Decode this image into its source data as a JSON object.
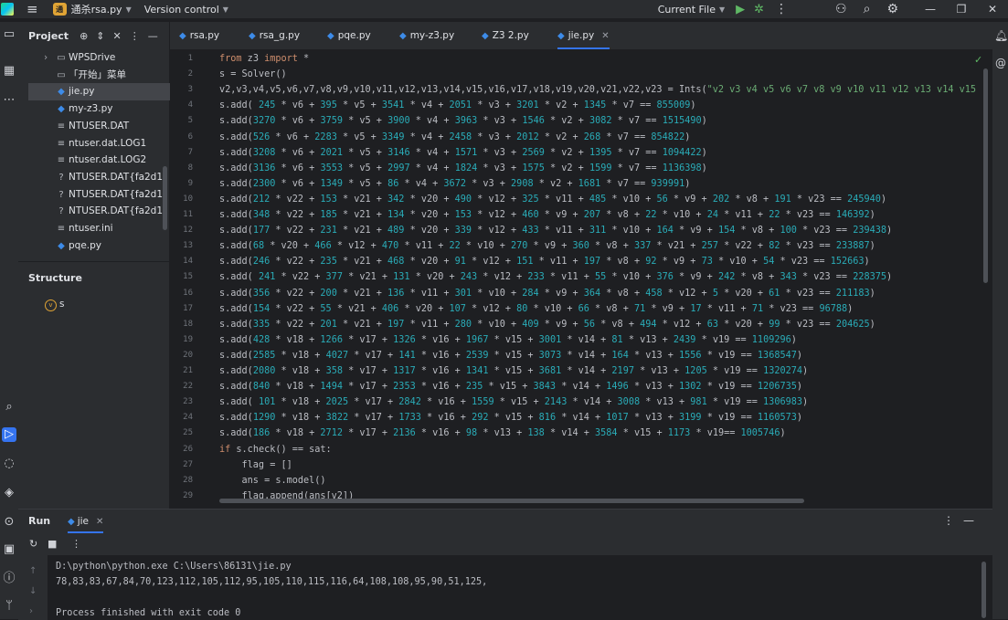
{
  "titlebar": {
    "project_badge": "通杀",
    "project_name": "通杀rsa.py",
    "vcs_label": "Version control",
    "current_file": "Current File"
  },
  "project_panel": {
    "title": "Project",
    "tree": [
      {
        "label": "WPSDrive",
        "type": "folder"
      },
      {
        "label": "「开始」菜单",
        "type": "folder"
      },
      {
        "label": "jie.py",
        "type": "py",
        "selected": true
      },
      {
        "label": "my-z3.py",
        "type": "py"
      },
      {
        "label": "NTUSER.DAT",
        "type": "file"
      },
      {
        "label": "ntuser.dat.LOG1",
        "type": "file"
      },
      {
        "label": "ntuser.dat.LOG2",
        "type": "file"
      },
      {
        "label": "NTUSER.DAT{fa2d155e-",
        "type": "unknown"
      },
      {
        "label": "NTUSER.DAT{fa2d155e-",
        "type": "unknown"
      },
      {
        "label": "NTUSER.DAT{fa2d155e-",
        "type": "unknown"
      },
      {
        "label": "ntuser.ini",
        "type": "file"
      },
      {
        "label": "pqe.py",
        "type": "py"
      }
    ],
    "structure_title": "Structure",
    "structure_item": "s"
  },
  "tabs": [
    {
      "label": "rsa.py"
    },
    {
      "label": "rsa_g.py"
    },
    {
      "label": "pqe.py"
    },
    {
      "label": "my-z3.py"
    },
    {
      "label": "Z3 2.py"
    },
    {
      "label": "jie.py",
      "active": true
    }
  ],
  "code_lines": [
    "from z3 import *",
    "s = Solver()",
    "v2,v3,v4,v5,v6,v7,v8,v9,v10,v11,v12,v13,v14,v15,v16,v17,v18,v19,v20,v21,v22,v23 = Ints(\"v2 v3 v4 v5 v6 v7 v8 v9 v10 v11 v12 v13 v14 v15",
    "s.add( 245 * v6 + 395 * v5 + 3541 * v4 + 2051 * v3 + 3201 * v2 + 1345 * v7 == 855009)",
    "s.add(3270 * v6 + 3759 * v5 + 3900 * v4 + 3963 * v3 + 1546 * v2 + 3082 * v7 == 1515490)",
    "s.add(526 * v6 + 2283 * v5 + 3349 * v4 + 2458 * v3 + 2012 * v2 + 268 * v7 == 854822)",
    "s.add(3208 * v6 + 2021 * v5 + 3146 * v4 + 1571 * v3 + 2569 * v2 + 1395 * v7 == 1094422)",
    "s.add(3136 * v6 + 3553 * v5 + 2997 * v4 + 1824 * v3 + 1575 * v2 + 1599 * v7 == 1136398)",
    "s.add(2300 * v6 + 1349 * v5 + 86 * v4 + 3672 * v3 + 2908 * v2 + 1681 * v7 == 939991)",
    "s.add(212 * v22 + 153 * v21 + 342 * v20 + 490 * v12 + 325 * v11 + 485 * v10 + 56 * v9 + 202 * v8 + 191 * v23 == 245940)",
    "s.add(348 * v22 + 185 * v21 + 134 * v20 + 153 * v12 + 460 * v9 + 207 * v8 + 22 * v10 + 24 * v11 + 22 * v23 == 146392)",
    "s.add(177 * v22 + 231 * v21 + 489 * v20 + 339 * v12 + 433 * v11 + 311 * v10 + 164 * v9 + 154 * v8 + 100 * v23 == 239438)",
    "s.add(68 * v20 + 466 * v12 + 470 * v11 + 22 * v10 + 270 * v9 + 360 * v8 + 337 * v21 + 257 * v22 + 82 * v23 == 233887)",
    "s.add(246 * v22 + 235 * v21 + 468 * v20 + 91 * v12 + 151 * v11 + 197 * v8 + 92 * v9 + 73 * v10 + 54 * v23 == 152663)",
    "s.add( 241 * v22 + 377 * v21 + 131 * v20 + 243 * v12 + 233 * v11 + 55 * v10 + 376 * v9 + 242 * v8 + 343 * v23 == 228375)",
    "s.add(356 * v22 + 200 * v21 + 136 * v11 + 301 * v10 + 284 * v9 + 364 * v8 + 458 * v12 + 5 * v20 + 61 * v23 == 211183)",
    "s.add(154 * v22 + 55 * v21 + 406 * v20 + 107 * v12 + 80 * v10 + 66 * v8 + 71 * v9 + 17 * v11 + 71 * v23 == 96788)",
    "s.add(335 * v22 + 201 * v21 + 197 * v11 + 280 * v10 + 409 * v9 + 56 * v8 + 494 * v12 + 63 * v20 + 99 * v23 == 204625)",
    "s.add(428 * v18 + 1266 * v17 + 1326 * v16 + 1967 * v15 + 3001 * v14 + 81 * v13 + 2439 * v19 == 1109296)",
    "s.add(2585 * v18 + 4027 * v17 + 141 * v16 + 2539 * v15 + 3073 * v14 + 164 * v13 + 1556 * v19 == 1368547)",
    "s.add(2080 * v18 + 358 * v17 + 1317 * v16 + 1341 * v15 + 3681 * v14 + 2197 * v13 + 1205 * v19 == 1320274)",
    "s.add(840 * v18 + 1494 * v17 + 2353 * v16 + 235 * v15 + 3843 * v14 + 1496 * v13 + 1302 * v19 == 1206735)",
    "s.add( 101 * v18 + 2025 * v17 + 2842 * v16 + 1559 * v15 + 2143 * v14 + 3008 * v13 + 981 * v19 == 1306983)",
    "s.add(1290 * v18 + 3822 * v17 + 1733 * v16 + 292 * v15 + 816 * v14 + 1017 * v13 + 3199 * v19 == 1160573)",
    "s.add(186 * v18 + 2712 * v17 + 2136 * v16 + 98 * v13 + 138 * v14 + 3584 * v15 + 1173 * v19== 1005746)",
    "if s.check() == sat:",
    "    flag = []",
    "    ans = s.model()",
    "    flag.append(ans[v2])"
  ],
  "run_panel": {
    "title": "Run",
    "tab_label": "jie",
    "output": [
      "D:\\python\\python.exe C:\\Users\\86131\\jie.py",
      "78,83,83,67,84,70,123,112,105,112,95,105,110,115,116,64,108,108,95,90,51,125,",
      "",
      "Process finished with exit code 0"
    ]
  },
  "colors": {
    "keyword": "#cf8e6d",
    "number": "#2aacb8",
    "string": "#6aab73",
    "accent": "#3574f0"
  }
}
